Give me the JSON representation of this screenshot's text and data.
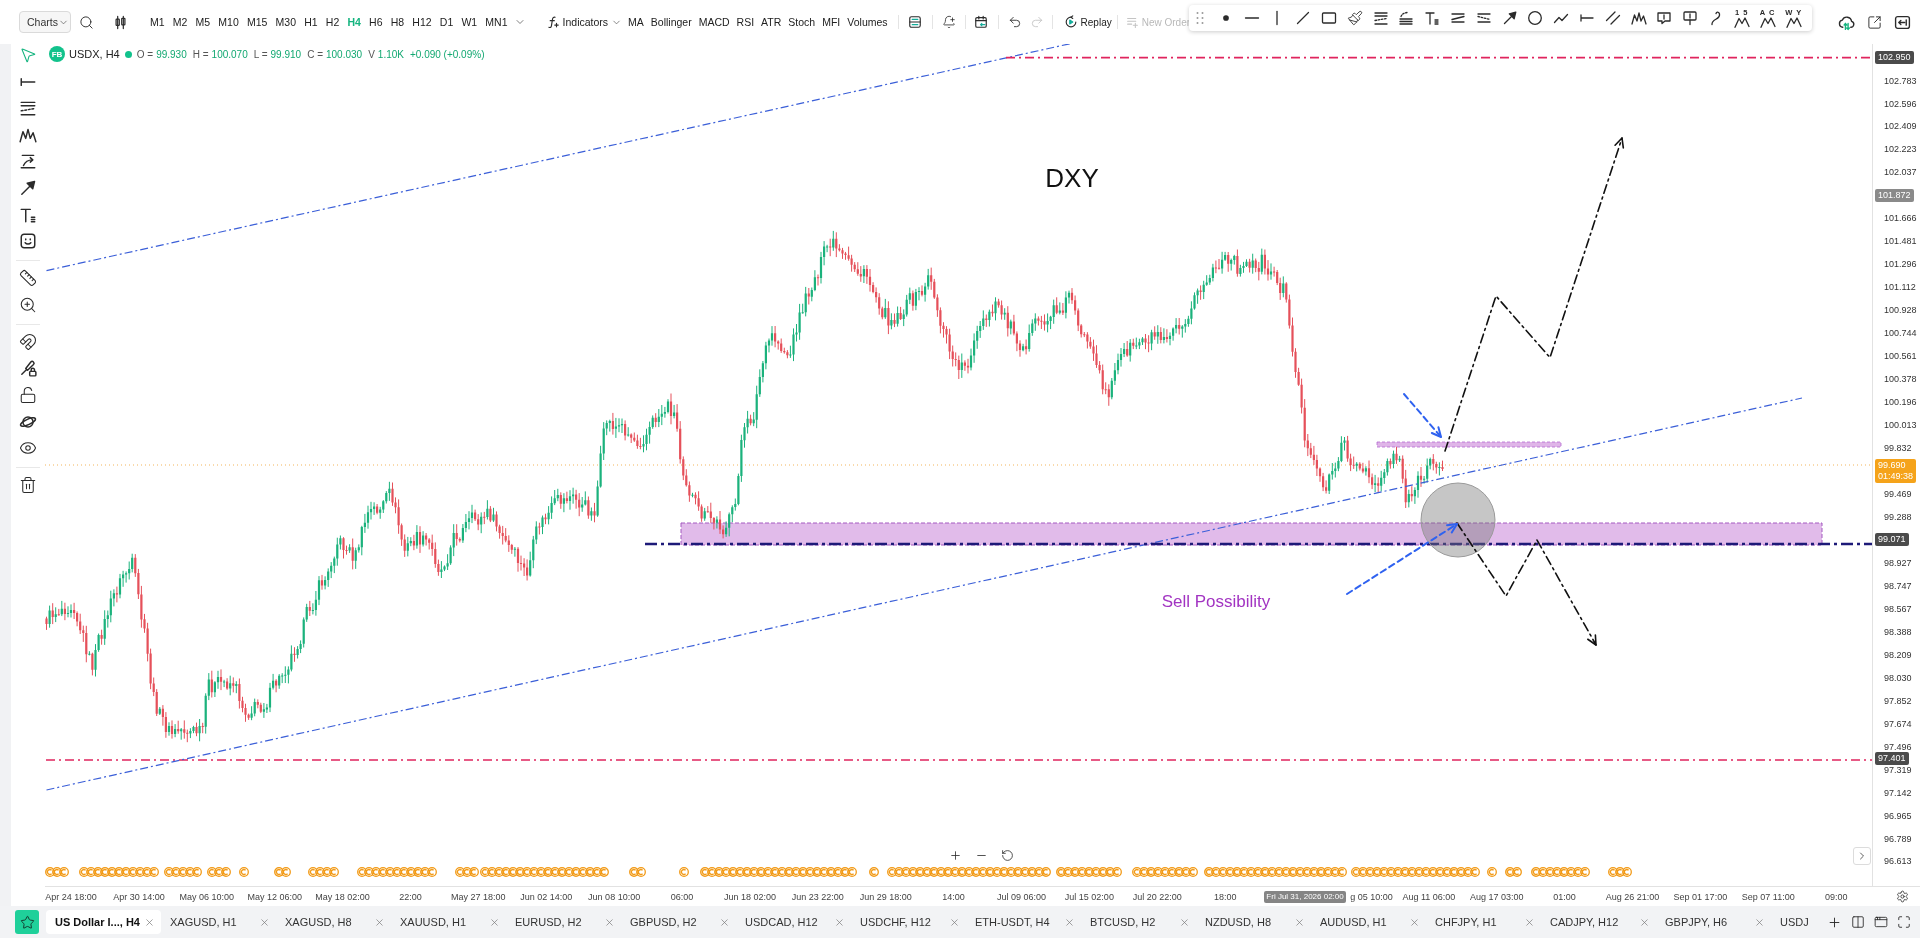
{
  "toolbar": {
    "charts_menu": "Charts",
    "timeframes": [
      {
        "label": "M1",
        "selected": false
      },
      {
        "label": "M2",
        "selected": false
      },
      {
        "label": "M5",
        "selected": false
      },
      {
        "label": "M10",
        "selected": false
      },
      {
        "label": "M15",
        "selected": false
      },
      {
        "label": "M30",
        "selected": false
      },
      {
        "label": "H1",
        "selected": false
      },
      {
        "label": "H2",
        "selected": false
      },
      {
        "label": "H4",
        "selected": true
      },
      {
        "label": "H6",
        "selected": false
      },
      {
        "label": "H8",
        "selected": false
      },
      {
        "label": "H12",
        "selected": false
      },
      {
        "label": "D1",
        "selected": false
      },
      {
        "label": "W1",
        "selected": false
      },
      {
        "label": "MN1",
        "selected": false
      }
    ],
    "indicators_menu": "Indicators",
    "indicators": [
      "MA",
      "Bollinger",
      "MACD",
      "RSI",
      "ATR",
      "Stoch",
      "MFI",
      "Volumes"
    ],
    "history": [
      {
        "kind": "undo",
        "disabled": false
      },
      {
        "kind": "redo",
        "disabled": true
      }
    ],
    "replay": "Replay",
    "new_order": {
      "label": "New Order",
      "disabled": true
    }
  },
  "drawing_bar": {
    "wave_labels": [
      "1 5",
      "A C",
      "W Y"
    ]
  },
  "left_toolbar": {
    "groups": [
      [
        {
          "kind": "cursor",
          "selected": true
        },
        {
          "kind": "horizontal_ray",
          "selected": false
        },
        {
          "kind": "stacked_lines",
          "selected": false
        },
        {
          "kind": "peaks",
          "selected": false
        },
        {
          "kind": "curved_arrow",
          "selected": false
        },
        {
          "kind": "arrow",
          "selected": false
        },
        {
          "kind": "text",
          "selected": false
        },
        {
          "kind": "smiley",
          "selected": false
        }
      ],
      [
        {
          "kind": "ruler",
          "selected": false
        },
        {
          "kind": "zoom_in",
          "selected": false
        }
      ],
      [
        {
          "kind": "magnet",
          "selected": false
        },
        {
          "kind": "brush_lock",
          "selected": false
        },
        {
          "kind": "unlock",
          "selected": false
        },
        {
          "kind": "planet",
          "selected": false
        },
        {
          "kind": "eye",
          "selected": false
        }
      ],
      [
        {
          "kind": "trash",
          "selected": false
        }
      ]
    ]
  },
  "legend": {
    "logo": "FB",
    "symbol": "USDX, H4",
    "fields": [
      {
        "label": "O =",
        "value": "99.930"
      },
      {
        "label": "H =",
        "value": "100.070"
      },
      {
        "label": "L =",
        "value": "99.910"
      },
      {
        "label": "C =",
        "value": "100.030"
      },
      {
        "label": "V",
        "value": "1.10K"
      }
    ],
    "change": "+0.090 (+0.09%)"
  },
  "chart": {
    "annotations": [
      {
        "kind": "title",
        "text": "DXY"
      },
      {
        "kind": "note",
        "text": "Sell Possibility"
      }
    ]
  },
  "price_axis": [
    {
      "kind": "level",
      "text": "102.950"
    },
    {
      "kind": "tick",
      "text": "102.783"
    },
    {
      "kind": "tick",
      "text": "102.596"
    },
    {
      "kind": "tick",
      "text": "102.409"
    },
    {
      "kind": "tick",
      "text": "102.223"
    },
    {
      "kind": "tick",
      "text": "102.037"
    },
    {
      "kind": "crosshair",
      "text": "101.872"
    },
    {
      "kind": "tick",
      "text": "101.666"
    },
    {
      "kind": "tick",
      "text": "101.481"
    },
    {
      "kind": "tick",
      "text": "101.296"
    },
    {
      "kind": "tick",
      "text": "101.112"
    },
    {
      "kind": "tick",
      "text": "100.928"
    },
    {
      "kind": "tick",
      "text": "100.744"
    },
    {
      "kind": "tick",
      "text": "100.561"
    },
    {
      "kind": "tick",
      "text": "100.378"
    },
    {
      "kind": "tick",
      "text": "100.196"
    },
    {
      "kind": "tick",
      "text": "100.013"
    },
    {
      "kind": "tick",
      "text": "99.832"
    },
    {
      "kind": "last_price",
      "text": "99.690",
      "countdown": "01:49:38"
    },
    {
      "kind": "tick",
      "text": "99.469"
    },
    {
      "kind": "tick",
      "text": "99.288"
    },
    {
      "kind": "level",
      "text": "99.071"
    },
    {
      "kind": "tick",
      "text": "98.927"
    },
    {
      "kind": "tick",
      "text": "98.747"
    },
    {
      "kind": "tick",
      "text": "98.567"
    },
    {
      "kind": "tick",
      "text": "98.388"
    },
    {
      "kind": "tick",
      "text": "98.209"
    },
    {
      "kind": "tick",
      "text": "98.030"
    },
    {
      "kind": "tick",
      "text": "97.852"
    },
    {
      "kind": "tick",
      "text": "97.674"
    },
    {
      "kind": "tick",
      "text": "97.496"
    },
    {
      "kind": "level",
      "text": "97.401"
    },
    {
      "kind": "tick",
      "text": "97.319"
    },
    {
      "kind": "tick",
      "text": "97.142"
    },
    {
      "kind": "tick",
      "text": "96.965"
    },
    {
      "kind": "tick",
      "text": "96.789"
    },
    {
      "kind": "tick",
      "text": "96.613"
    }
  ],
  "time_axis": [
    {
      "kind": "tick",
      "text": "Apr 24 18:00"
    },
    {
      "kind": "tick",
      "text": "Apr 30 14:00"
    },
    {
      "kind": "tick",
      "text": "May 06 10:00"
    },
    {
      "kind": "tick",
      "text": "May 12 06:00"
    },
    {
      "kind": "tick",
      "text": "May 18 02:00"
    },
    {
      "kind": "tick",
      "text": "22:00"
    },
    {
      "kind": "tick",
      "text": "May 27 18:00"
    },
    {
      "kind": "tick",
      "text": "Jun 02 14:00"
    },
    {
      "kind": "tick",
      "text": "Jun 08 10:00"
    },
    {
      "kind": "tick",
      "text": "06:00"
    },
    {
      "kind": "tick",
      "text": "Jun 18 02:00"
    },
    {
      "kind": "tick",
      "text": "Jun 23 22:00"
    },
    {
      "kind": "tick",
      "text": "Jun 29 18:00"
    },
    {
      "kind": "tick",
      "text": "14:00"
    },
    {
      "kind": "tick",
      "text": "Jul 09 06:00"
    },
    {
      "kind": "tick",
      "text": "Jul 15 02:00"
    },
    {
      "kind": "tick",
      "text": "Jul 20 22:00"
    },
    {
      "kind": "tick",
      "text": "18:00"
    },
    {
      "kind": "crosshair",
      "text": "Fri Jul 31, 2026 02:00"
    },
    {
      "kind": "clipped",
      "text": "g 05 10:00"
    },
    {
      "kind": "tick",
      "text": "Aug 11 06:00"
    },
    {
      "kind": "tick",
      "text": "Aug 17 03:00"
    },
    {
      "kind": "tick",
      "text": "01:00"
    },
    {
      "kind": "tick",
      "text": "Aug 26 21:00"
    },
    {
      "kind": "tick",
      "text": "Sep 01 17:00"
    },
    {
      "kind": "tick",
      "text": "Sep 07 11:00"
    },
    {
      "kind": "tick",
      "text": "09:00"
    }
  ],
  "tabs": [
    {
      "label": "US Dollar I..., H4",
      "selected": true,
      "closable": true
    },
    {
      "label": "XAGUSD, H1",
      "selected": false,
      "closable": true
    },
    {
      "label": "XAGUSD, H8",
      "selected": false,
      "closable": true
    },
    {
      "label": "XAUUSD, H1",
      "selected": false,
      "closable": true
    },
    {
      "label": "EURUSD, H2",
      "selected": false,
      "closable": true
    },
    {
      "label": "GBPUSD, H2",
      "selected": false,
      "closable": true
    },
    {
      "label": "USDCAD, H12",
      "selected": false,
      "closable": true
    },
    {
      "label": "USDCHF, H12",
      "selected": false,
      "closable": true
    },
    {
      "label": "ETH-USDT, H4",
      "selected": false,
      "closable": true
    },
    {
      "label": "BTCUSD, H2",
      "selected": false,
      "closable": true
    },
    {
      "label": "NZDUSD, H8",
      "selected": false,
      "closable": true
    },
    {
      "label": "AUDUSD, H1",
      "selected": false,
      "closable": true
    },
    {
      "label": "CHFJPY, H1",
      "selected": false,
      "closable": true
    },
    {
      "label": "CADJPY, H12",
      "selected": false,
      "closable": true
    },
    {
      "label": "GBPJPY, H6",
      "selected": false,
      "closable": true
    },
    {
      "label": "USDJ",
      "selected": false,
      "closable": false
    }
  ]
}
